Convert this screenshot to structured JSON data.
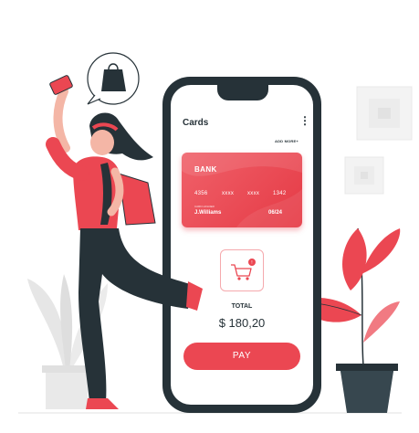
{
  "screen": {
    "title": "Cards",
    "menu_glyph": "⋮",
    "add_more_label": "ADD MORE+"
  },
  "card": {
    "bank_label": "BANK",
    "number_groups": [
      "4356",
      "xxxx",
      "xxxx",
      "1342"
    ],
    "holder_label": "CARD HOLDER",
    "holder_name": "J.Williams",
    "expiry": "06/24"
  },
  "cart": {
    "icon": "shopping-cart-icon",
    "badge": "!"
  },
  "total": {
    "label": "TOTAL",
    "amount": "$ 180,20"
  },
  "pay_button": {
    "label": "PAY"
  },
  "colors": {
    "accent": "#eb4752",
    "dark": "#263238",
    "card_gradient_start": "#f0616a",
    "card_gradient_end": "#e53a45"
  }
}
